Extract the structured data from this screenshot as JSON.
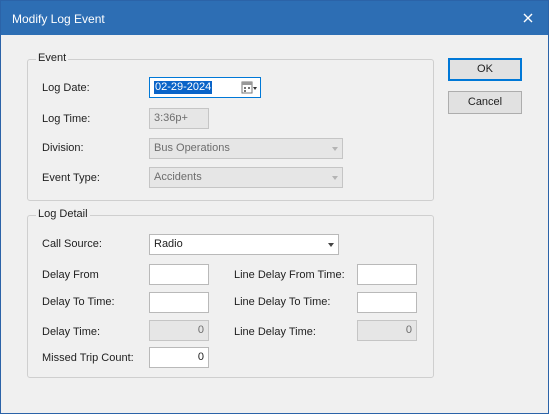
{
  "window": {
    "title": "Modify Log Event"
  },
  "buttons": {
    "ok": "OK",
    "cancel": "Cancel"
  },
  "event": {
    "legend": "Event",
    "log_date_label": "Log Date:",
    "log_date_value": "02-29-2024",
    "log_time_label": "Log Time:",
    "log_time_value": "3:36p+",
    "division_label": "Division:",
    "division_value": "Bus Operations",
    "event_type_label": "Event Type:",
    "event_type_value": "Accidents"
  },
  "log_detail": {
    "legend": "Log Detail",
    "call_source_label": "Call Source:",
    "call_source_value": "Radio",
    "delay_from_label": "Delay From",
    "delay_from_value": "",
    "line_delay_from_time_label": "Line Delay From Time:",
    "line_delay_from_time_value": "",
    "delay_to_time_label": "Delay To Time:",
    "delay_to_time_value": "",
    "line_delay_to_time_label": "Line Delay To Time:",
    "line_delay_to_time_value": "",
    "delay_time_label": "Delay Time:",
    "delay_time_value": "0",
    "line_delay_time_label": "Line Delay Time:",
    "line_delay_time_value": "0",
    "missed_trip_count_label": "Missed Trip Count:",
    "missed_trip_count_value": "0"
  },
  "icons": {
    "close": "close-icon",
    "calendar": "calendar-icon",
    "dropdown": "chevron-down-icon"
  }
}
